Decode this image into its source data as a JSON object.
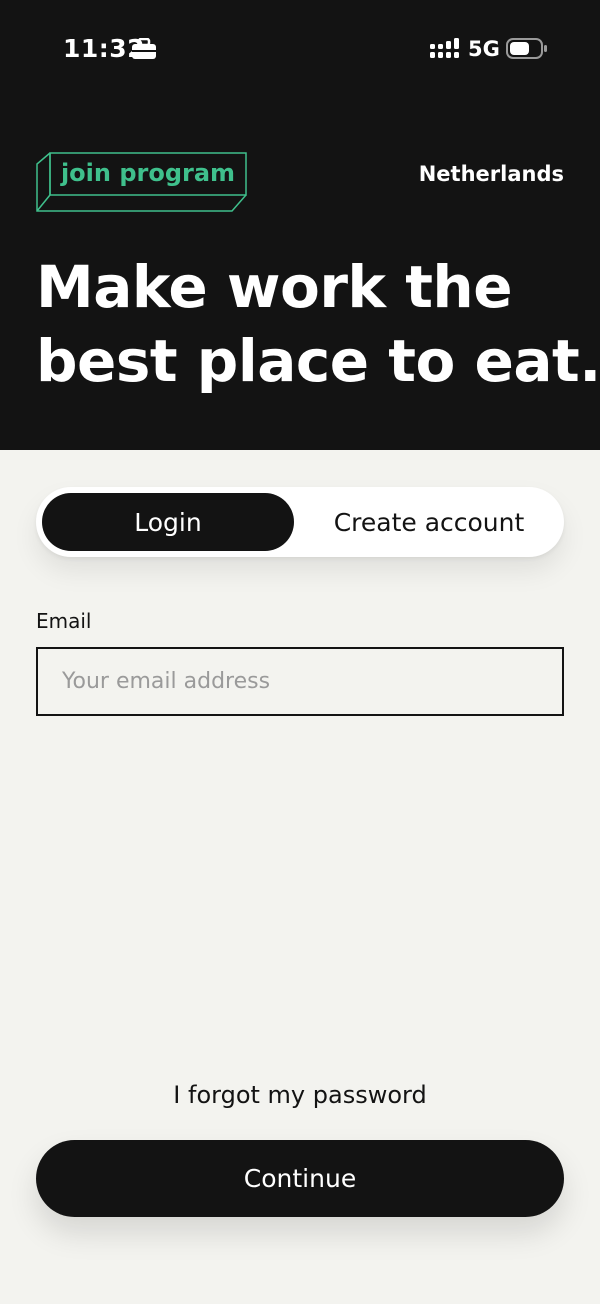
{
  "status_bar": {
    "time": "11:32",
    "network": "5G"
  },
  "header": {
    "join_label": "join program",
    "country": "Netherlands",
    "headline_line1": "Make work the",
    "headline_line2": "best place to eat."
  },
  "tabs": {
    "login": "Login",
    "create_account": "Create account",
    "active": "login"
  },
  "form": {
    "email_label": "Email",
    "email_placeholder": "Your email address",
    "email_value": ""
  },
  "actions": {
    "forgot_password": "I forgot my password",
    "continue": "Continue"
  },
  "colors": {
    "dark": "#131313",
    "accent_green": "#3fc08c",
    "background": "#f3f3ef"
  },
  "icons": [
    "briefcase-icon",
    "signal-icon",
    "battery-icon"
  ]
}
